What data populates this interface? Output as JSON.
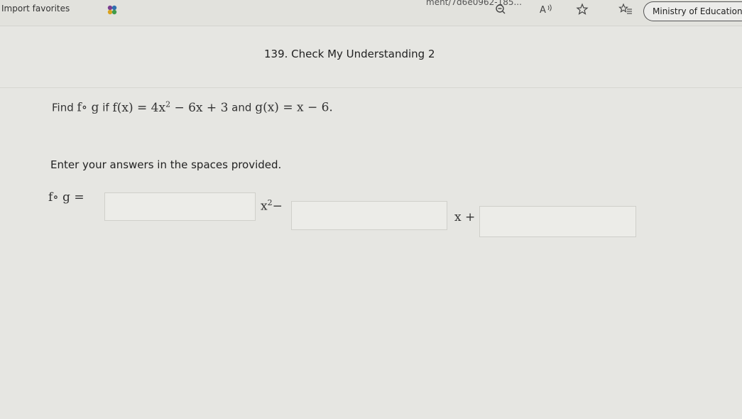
{
  "browser": {
    "favorites_label": "Import favorites",
    "address_fragment": "ment/7d6e0962-185...",
    "ministry_label": "Ministry of Education",
    "icons": [
      "zoom-out-icon",
      "read-aloud-icon",
      "favorite-star-icon",
      "favorites-list-icon"
    ]
  },
  "page": {
    "title": "139. Check My Understanding 2"
  },
  "question": {
    "find": "Find",
    "composition": "f∘ g",
    "if": "if",
    "f_def": "f(x) = 4x",
    "f_rest": " − 6x + 3",
    "and": "and",
    "g_def": "g(x) = x − 6.",
    "exp": "2"
  },
  "instruction": "Enter your answers in the spaces provided.",
  "answer": {
    "lhs": "f∘ g =",
    "term1": "x",
    "term1_exp": "2",
    "op1": "−",
    "term2": "x +",
    "input1_value": "",
    "input2_value": "",
    "input3_value": ""
  }
}
